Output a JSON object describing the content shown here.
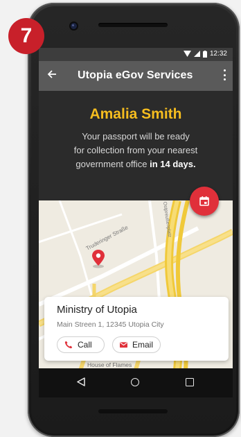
{
  "step_badge": "7",
  "status_bar": {
    "time": "12:32"
  },
  "app_bar": {
    "title": "Utopia eGov Services"
  },
  "message": {
    "name": "Amalia Smith",
    "line1": "Your passport will be ready",
    "line2": "for collection from your nearest",
    "line3_prefix": "government office ",
    "line3_bold": "in 14 days."
  },
  "map": {
    "street_labels": [
      "Truderinger Straße",
      "Ostpreußenplatz"
    ],
    "place_label": "House of Flames"
  },
  "office_card": {
    "title": "Ministry of Utopia",
    "address": "Main Streen 1, 12345 Utopia City",
    "call_label": "Call",
    "email_label": "Email"
  },
  "colors": {
    "accent_red": "#e0303a",
    "name_yellow": "#f6bd1f",
    "badge_red": "#c8202a"
  },
  "icons": {
    "fab": "calendar-icon",
    "back": "arrow-left-icon",
    "more": "more-vert-icon",
    "call": "phone-icon",
    "email": "mail-icon",
    "pin": "map-pin-icon"
  }
}
